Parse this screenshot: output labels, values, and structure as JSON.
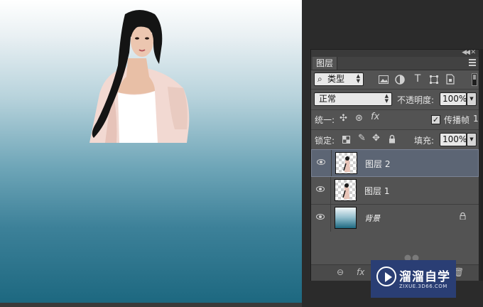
{
  "panel": {
    "tab_label": "图层",
    "filter": {
      "label": "类型"
    },
    "blend_mode": "正常",
    "opacity_label": "不透明度:",
    "opacity_value": "100%",
    "unify_label": "统一:",
    "propagate_label": "传播帧",
    "propagate_value": "1",
    "propagate_checked": true,
    "lock_label": "锁定:",
    "fill_label": "填充:",
    "fill_value": "100%"
  },
  "layers": [
    {
      "name": "图层 2",
      "selected": true,
      "visible": true
    },
    {
      "name": "图层 1",
      "selected": false,
      "visible": true
    },
    {
      "name": "背景",
      "selected": false,
      "visible": true,
      "locked": true
    }
  ],
  "watermark": {
    "title": "溜溜自学",
    "subtitle": "ZIXUE.3D66.COM"
  },
  "colors": {
    "panel_bg": "#535353",
    "selected_layer": "#5c6574",
    "canvas_top": "#ffffff",
    "canvas_bottom": "#1d6880",
    "watermark_bg": "#2a3e74"
  }
}
